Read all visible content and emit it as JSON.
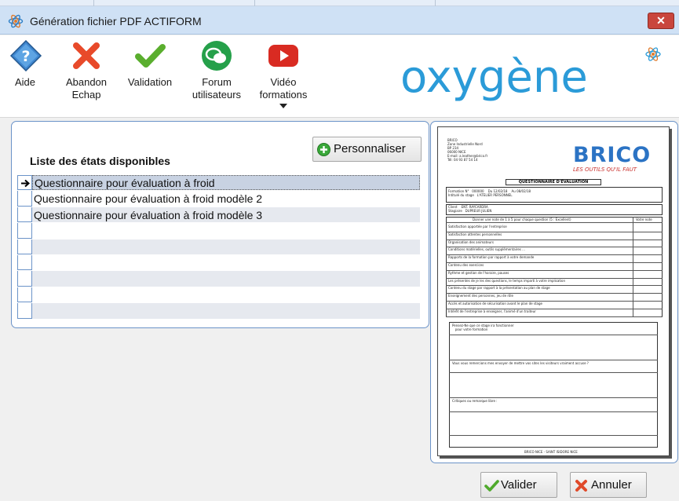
{
  "window": {
    "title": "Génération fichier PDF ACTIFORM",
    "close_label": "✕"
  },
  "toolbar": {
    "items": [
      {
        "label": "Aide",
        "label2": "",
        "icon": "help-icon"
      },
      {
        "label": "Abandon",
        "label2": "Echap",
        "icon": "abort-icon"
      },
      {
        "label": "Validation",
        "label2": "",
        "icon": "validation-check-icon"
      },
      {
        "label": "Forum",
        "label2": "utilisateurs",
        "icon": "forum-chat-icon"
      },
      {
        "label": "Vidéo",
        "label2": "formations",
        "icon": "video-play-icon"
      }
    ],
    "logo_text": "oxygène"
  },
  "list": {
    "title": "Liste des états disponibles",
    "personnaliser_label": "Personnaliser",
    "items": [
      "Questionnaire pour évaluation à froid",
      "Questionnaire pour évaluation à froid modèle 2",
      "Questionnaire pour évaluation à froid modèle 3"
    ],
    "selected_index": 0
  },
  "preview": {
    "company_lines": "BRICO\nZone Industrielle Nord\nBP 234\n06000 NICE\nE-mail: a.leather@brico.fr\nTél: 04 93 87 54 14",
    "brand": "BRICO",
    "brand_tagline": "LES OUTILS QU'IL FAUT",
    "doc_title": "QUESTIONNAIRE D'ÉVALUATION",
    "info_rows": "Formation N°   000000    Du 12/02/18    Au 08/02/18\nIntitulé du stage   L'ATELIER PERSONNEL",
    "client_rows": "Client    ENT. RAYCARDRA\nStagiaire   DUPREUR JULIEN",
    "criteria_header": "Donner une note de 1 à 5 pour chaque question (5 : Excellent)",
    "note_header": "Votre note",
    "criteria": [
      "Satisfaction apportée par l'entreprise",
      "Satisfaction attentes personnelles",
      "Organisation des animateurs",
      "Conditions matérielles, outils supplémentaires ...",
      "Rapports de la formation par rapport à votre demande",
      "Contenu des exercices",
      "Rythme et gestion de l'horaire, pauses",
      "Les présentes de je les des questions, le temps imparti à votre implication",
      "Contenu du stage par rapport à la présentation au plan de stage",
      "Enseignement des personnes, jeu de rôle",
      "Accès et autorisation de sécurisation avant le plan de stage",
      "Intérêt de l'entreprise à enseigner, l'animé d'un traiteur"
    ],
    "comment_labels": [
      "Pensez-Ne que ce stage ira fonctionner\n   pour votre formation",
      "Vous vous remercions mes envoyer de mettre vos sites les visiteurs vraiment accuse ?",
      "Critiques ou remarque libre :"
    ],
    "footer": "BRICO NICE - SAINT ISIDORE NICE"
  },
  "buttons": {
    "valider": "Valider",
    "annuler": "Annuler"
  },
  "colors": {
    "panel_border": "#6b93c8",
    "logo_blue": "#2b9bd8",
    "brand_blue": "#2b73c4"
  }
}
